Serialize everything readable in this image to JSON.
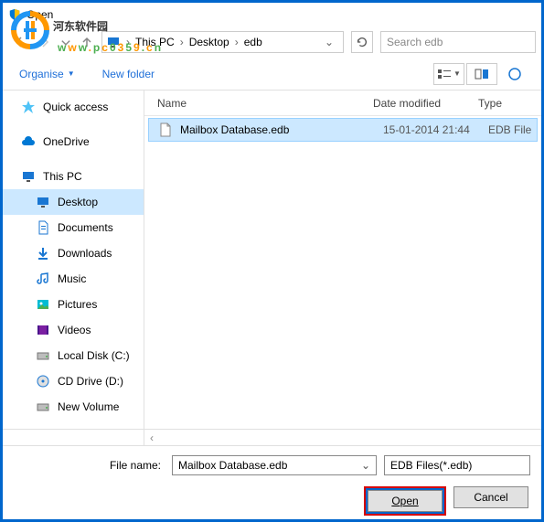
{
  "window": {
    "title": "Open"
  },
  "watermark": {
    "text": "河东软件园",
    "url_chars": [
      "w",
      "w",
      "w",
      ".",
      "p",
      "c",
      "0",
      "3",
      "5",
      "9",
      ".",
      "c",
      "n"
    ]
  },
  "nav": {
    "breadcrumb": [
      "This PC",
      "Desktop",
      "edb"
    ],
    "search_placeholder": "Search edb"
  },
  "toolbar": {
    "organise": "Organise",
    "newfolder": "New folder"
  },
  "columns": {
    "name": "Name",
    "date": "Date modified",
    "type": "Type"
  },
  "sidebar": {
    "quick": "Quick access",
    "onedrive": "OneDrive",
    "thispc": "This PC",
    "desktop": "Desktop",
    "documents": "Documents",
    "downloads": "Downloads",
    "music": "Music",
    "pictures": "Pictures",
    "videos": "Videos",
    "localdisk": "Local Disk (C:)",
    "cddrive": "CD Drive (D:)",
    "newvolume": "New Volume"
  },
  "files": [
    {
      "name": "Mailbox Database.edb",
      "date": "15-01-2014 21:44",
      "type": "EDB File"
    }
  ],
  "bottom": {
    "filename_label": "File name:",
    "filename_value": "Mailbox Database.edb",
    "filter": "EDB Files(*.edb)",
    "open": "Open",
    "cancel": "Cancel"
  }
}
